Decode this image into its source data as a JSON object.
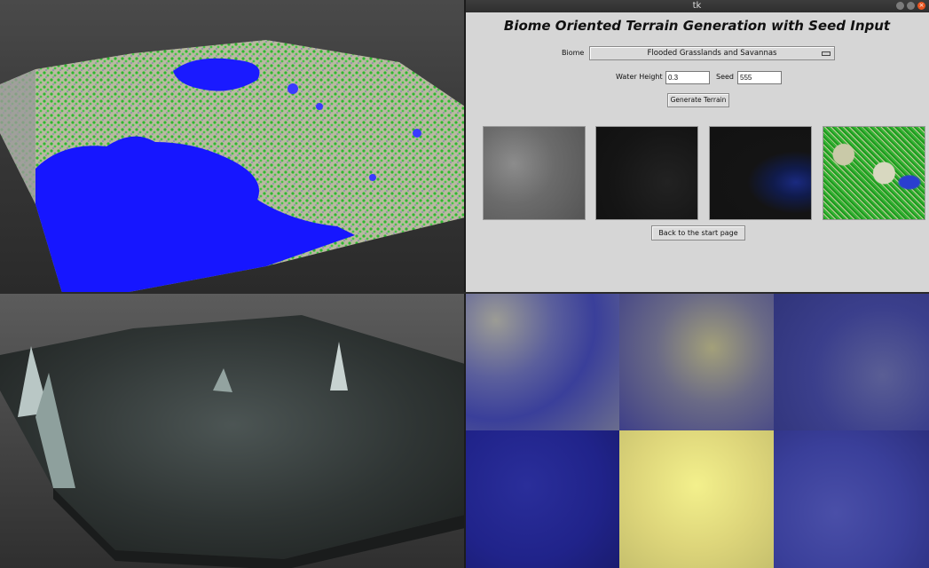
{
  "window": {
    "title": "tk"
  },
  "app": {
    "title": "Biome Oriented Terrain Generation with Seed Input",
    "biome_label": "Biome",
    "biome_selected": "Flooded Grasslands and Savannas",
    "water_height_label": "Water Height",
    "water_height_value": "0.3",
    "seed_label": "Seed",
    "seed_value": "555",
    "generate_button": "Generate Terrain",
    "back_button": "Back to the start page"
  },
  "icons": {
    "window_minimize": "minimize-icon",
    "window_maximize": "maximize-icon",
    "window_close": "close-icon",
    "dropdown_indicator": "dropdown-indicator-icon"
  },
  "colors": {
    "water": "#1a1aff",
    "grass_green": "#2fb82f",
    "ui_background": "#d6d6d6",
    "close_button": "#e95420"
  }
}
